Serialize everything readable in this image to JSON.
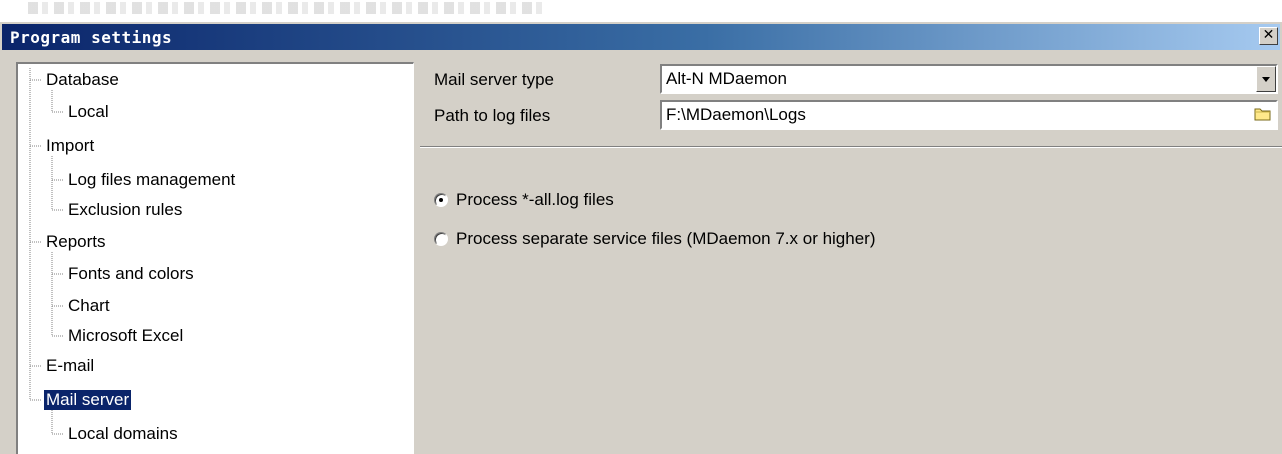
{
  "window": {
    "title": "Program settings",
    "close_label": "✕"
  },
  "tree": {
    "items": [
      {
        "label": "Database",
        "level": 0
      },
      {
        "label": "Local",
        "level": 1
      },
      {
        "label": "Import",
        "level": 0
      },
      {
        "label": "Log files management",
        "level": 1
      },
      {
        "label": "Exclusion rules",
        "level": 1
      },
      {
        "label": "Reports",
        "level": 0
      },
      {
        "label": "Fonts and colors",
        "level": 1
      },
      {
        "label": "Chart",
        "level": 1
      },
      {
        "label": "Microsoft Excel",
        "level": 1
      },
      {
        "label": "E-mail",
        "level": 0
      },
      {
        "label": "Mail server",
        "level": 0,
        "selected": true
      },
      {
        "label": "Local domains",
        "level": 1
      }
    ]
  },
  "form": {
    "mail_server_type": {
      "label": "Mail server type",
      "value": "Alt-N MDaemon"
    },
    "log_path": {
      "label": "Path to log files",
      "value": "F:\\MDaemon\\Logs"
    },
    "radios": [
      {
        "label": "Process *-all.log files",
        "checked": true
      },
      {
        "label": "Process separate service files (MDaemon 7.x or higher)",
        "checked": false
      }
    ]
  },
  "icons": {
    "dropdown": "chevron-down-icon",
    "browse": "folder-icon",
    "close": "close-icon"
  },
  "colors": {
    "title_start": "#0a246a",
    "title_end": "#a6caf0",
    "face": "#d4d0c8",
    "selection": "#0a246a"
  }
}
